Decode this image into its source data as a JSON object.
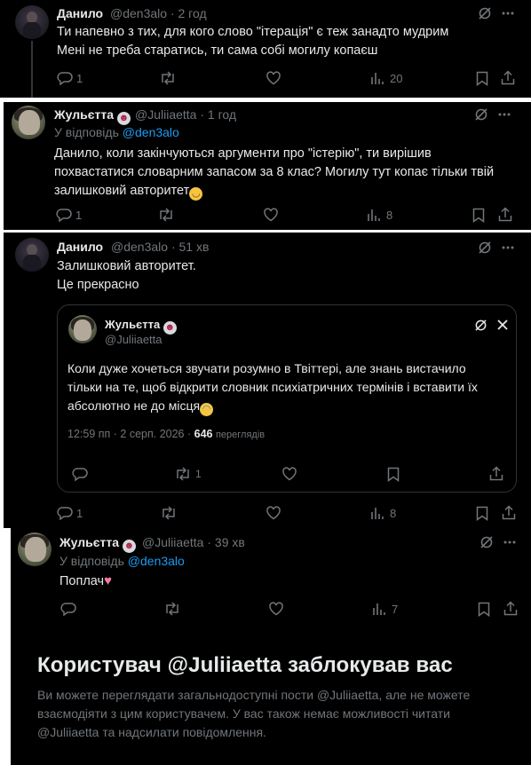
{
  "tweet1": {
    "author_name": "Данило",
    "handle": "@den3alo",
    "time": "2 год",
    "lines": [
      "Ти напевно з тих, для кого слово \"ітерація\" є теж занадто мудрим",
      "Мені не треба старатись, ти сама собі могилу копаєш"
    ],
    "replies": "1",
    "views": "20"
  },
  "tweet2": {
    "author_name": "Жульєтта",
    "handle": "@Juliiaetta",
    "time": "1 год",
    "reply_prefix": "У відповідь",
    "reply_to": "@den3alo",
    "lines": [
      "Данило, коли закінчуються аргументи про \"істерію\", ти вирішив",
      "похвастатися словарним запасом за 8 клас? Могилу тут копає тільки твій",
      "залишковий авторитет"
    ],
    "replies": "1",
    "views": "8"
  },
  "tweet3": {
    "author_name": "Данило",
    "handle": "@den3alo",
    "time": "51 хв",
    "lines": [
      "Залишковий авторитет.",
      "Це прекрасно"
    ],
    "replies": "1",
    "views": "8",
    "quote": {
      "author_name": "Жульєтта",
      "handle": "@Juliiaetta",
      "lines": [
        "Коли дуже хочеться звучати розумно в Твіттері, але знань вистачило",
        "тільки на те, щоб відкрити словник психіатричних термінів і вставити їх",
        "абсолютно не до місця"
      ],
      "timestamp": "12:59 пп · 2 серп. 2026 ·",
      "views_count": "646",
      "views_label": "переглядів",
      "retweets": "1"
    }
  },
  "tweet4": {
    "author_name": "Жульєтта",
    "handle": "@Juliiaetta",
    "time": "39 хв",
    "reply_prefix": "У відповідь",
    "reply_to": "@den3alo",
    "text": "Поплач",
    "views": "7"
  },
  "blocked": {
    "title": "Користувач @Juliiaetta заблокував вас",
    "description_lines": [
      "Ви можете переглядати загальнодоступні пости @Juliiaetta, але не можете",
      "взаємодіяти з цим користувачем. У вас також немає можливості читати",
      "@Juliiaetta та надсилати повідомлення."
    ]
  },
  "meta_separator": "·",
  "icons": [
    "grok-icon",
    "more-icon",
    "reply-icon",
    "retweet-icon",
    "like-icon",
    "views-icon",
    "bookmark-icon",
    "share-icon",
    "devil-emoji",
    "relieved-emoji",
    "laughing-emoji",
    "pink-heart-emoji"
  ],
  "colors": {
    "background": "#000000",
    "text": "#e7e9ea",
    "muted": "#71767b",
    "link": "#1d9bf0",
    "border": "#2f3336"
  }
}
